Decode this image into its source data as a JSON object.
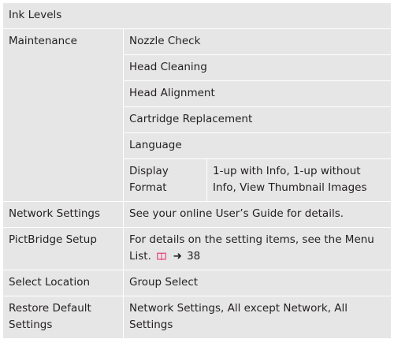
{
  "rows": {
    "ink_levels": "Ink Levels",
    "maintenance": {
      "label": "Maintenance",
      "items": [
        "Nozzle Check",
        "Head Cleaning",
        "Head Alignment",
        "Cartridge Replacement",
        "Language"
      ],
      "display_format": {
        "label": "Display Format",
        "value": "1-up with Info, 1-up without Info, View Thumbnail Images"
      }
    },
    "network_settings": {
      "label": "Network Settings",
      "value": "See your online User’s Guide for details."
    },
    "pictbridge_setup": {
      "label": "PictBridge Setup",
      "value": "For details on the setting items, see the Menu List.",
      "page_ref": "38"
    },
    "select_location": {
      "label": "Select Location",
      "value": "Group Select"
    },
    "restore_default": {
      "label": "Restore Default Settings",
      "value": "Network Settings, All except Network, All Settings"
    }
  },
  "icons": {
    "manual_icon": "book-icon",
    "arrow_icon": "right-arrow-icon"
  },
  "colors": {
    "cell_background": "#e6e6e7",
    "border": "#ffffff",
    "text": "#231f20",
    "manual_icon": "#e8336e"
  }
}
